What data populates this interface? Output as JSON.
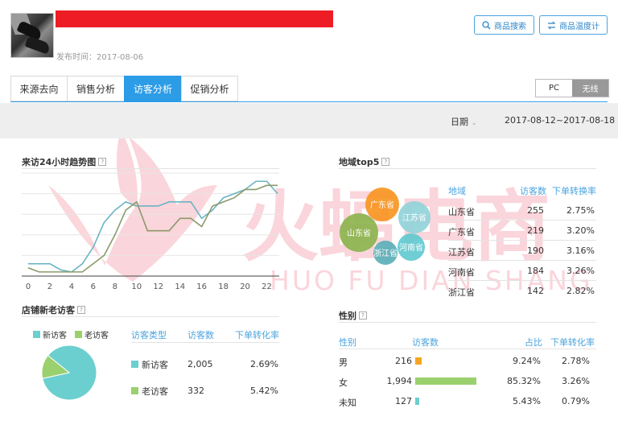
{
  "header": {
    "publish_label": "发布时间：2017-08-06",
    "search_button": "商品搜索",
    "temp_button": "商品温度计"
  },
  "tabs": [
    {
      "label": "来源去向",
      "active": false
    },
    {
      "label": "销售分析",
      "active": false
    },
    {
      "label": "访客分析",
      "active": true
    },
    {
      "label": "促销分析",
      "active": false
    }
  ],
  "device": {
    "pc": "PC",
    "wireless": "无线",
    "selected": "无线"
  },
  "date_filter": {
    "label": "日期",
    "range": "2017-08-12~2017-08-18"
  },
  "trend": {
    "title": "来访24小时趋势图",
    "help": "?"
  },
  "region": {
    "title": "地域top5",
    "help": "?",
    "headers": [
      "地域",
      "访客数",
      "下单转换率"
    ],
    "rows": [
      {
        "region": "山东省",
        "visitors": "255",
        "rate": "2.75%"
      },
      {
        "region": "广东省",
        "visitors": "219",
        "rate": "3.20%"
      },
      {
        "region": "江苏省",
        "visitors": "190",
        "rate": "3.16%"
      },
      {
        "region": "河南省",
        "visitors": "184",
        "rate": "3.26%"
      },
      {
        "region": "浙江省",
        "visitors": "142",
        "rate": "2.82%"
      }
    ],
    "bubbles": [
      {
        "label": "广东省",
        "color": "#f7941d"
      },
      {
        "label": "江苏省",
        "color": "#8fd3d9"
      },
      {
        "label": "山东省",
        "color": "#8ab24a"
      },
      {
        "label": "河南省",
        "color": "#5ec9cf"
      },
      {
        "label": "浙江省",
        "color": "#58aeb7"
      }
    ]
  },
  "visitors": {
    "title": "店铺新老访客",
    "help": "?",
    "legend_new": "新访客",
    "legend_old": "老访客",
    "headers": [
      "访客类型",
      "访客数",
      "下单转化率"
    ],
    "rows": [
      {
        "type": "新访客",
        "count": "2,005",
        "rate": "2.69%",
        "color": "#6ccfcf"
      },
      {
        "type": "老访客",
        "count": "332",
        "rate": "5.42%",
        "color": "#9bd06e"
      }
    ]
  },
  "gender": {
    "title": "性别",
    "help": "?",
    "headers": [
      "性别",
      "访客数",
      "占比",
      "下单转化率"
    ],
    "rows": [
      {
        "gender": "男",
        "count": "216",
        "share": "9.24%",
        "rate": "2.78%",
        "bar_color": "#f5a623",
        "bar_fraction": 0.108
      },
      {
        "gender": "女",
        "count": "1,994",
        "share": "85.32%",
        "rate": "3.26%",
        "bar_color": "#9bd06e",
        "bar_fraction": 1.0
      },
      {
        "gender": "未知",
        "count": "127",
        "share": "5.43%",
        "rate": "0.79%",
        "bar_color": "#6ccfcf",
        "bar_fraction": 0.064
      }
    ]
  },
  "watermark": {
    "main": "火蝠电商",
    "sub": "HUO FU DIAN SHANG"
  },
  "chart_data": [
    {
      "type": "line",
      "x": [
        0,
        1,
        2,
        3,
        4,
        5,
        6,
        7,
        8,
        9,
        10,
        11,
        12,
        13,
        14,
        15,
        16,
        17,
        18,
        19,
        20,
        21,
        22,
        23
      ],
      "xticks": [
        0,
        2,
        4,
        6,
        8,
        10,
        12,
        14,
        16,
        18,
        20,
        22
      ],
      "series": [
        {
          "color": "#6ab4c4",
          "values": [
            3,
            3,
            3,
            1.5,
            1,
            3,
            7,
            13,
            16,
            18,
            17,
            17,
            17,
            18,
            18,
            18,
            14,
            16,
            19,
            20,
            21,
            23,
            23,
            20
          ]
        },
        {
          "color": "#8a9a6a",
          "values": [
            2,
            1,
            1,
            1,
            1,
            1,
            3,
            5,
            10,
            16,
            18,
            11,
            11,
            11,
            14,
            14,
            12,
            17,
            18,
            19,
            21,
            21,
            22,
            22
          ]
        }
      ],
      "ylim": [
        0,
        25
      ],
      "grid": true
    },
    {
      "type": "pie",
      "labels": [
        "新访客",
        "老访客"
      ],
      "values": [
        2005,
        332
      ],
      "colors": [
        "#6ccfcf",
        "#9bd06e"
      ]
    }
  ]
}
